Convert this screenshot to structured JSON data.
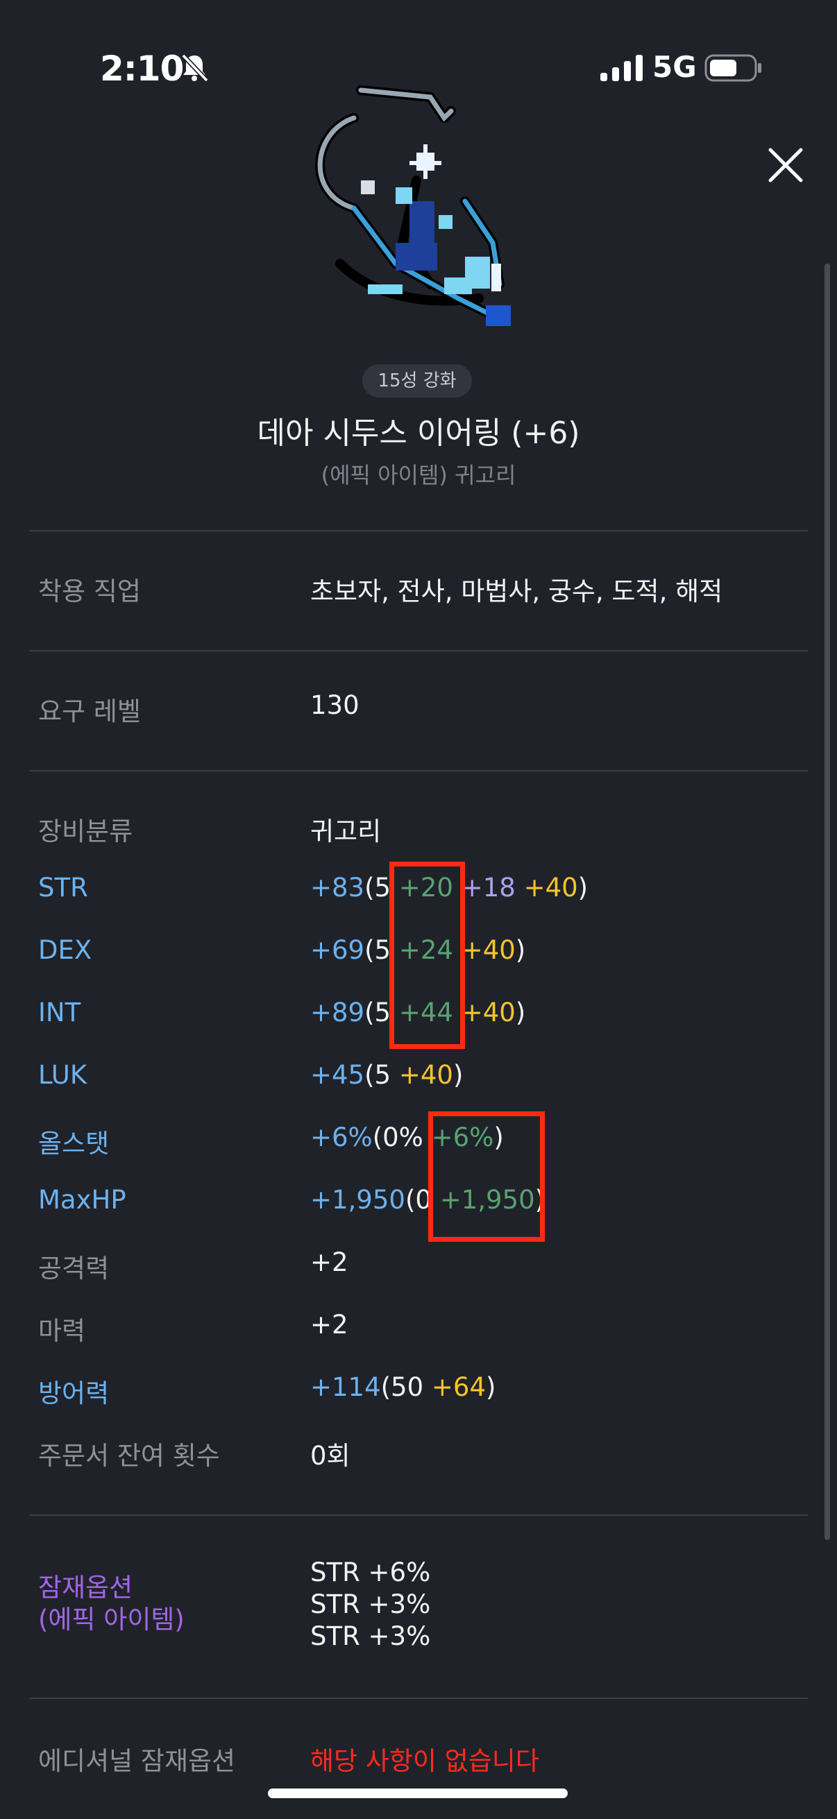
{
  "status_bar": {
    "time": "2:10",
    "network": "5G"
  },
  "item": {
    "badge": "15성 강화",
    "title": "데아 시두스 이어링 (+6)",
    "subtitle": "(에픽 아이템) 귀고리"
  },
  "rows": {
    "job": {
      "label": "착용 직업",
      "value": "초보자, 전사, 마법사, 궁수, 도적, 해적"
    },
    "level": {
      "label": "요구 레벨",
      "value": "130"
    },
    "category": {
      "label": "장비분류",
      "value": "귀고리"
    },
    "str": {
      "label": "STR",
      "total": "+83",
      "open": "(5 ",
      "bonus": "+20",
      "star": "+18",
      "enh": "+40",
      "close": ")"
    },
    "dex": {
      "label": "DEX",
      "total": "+69",
      "open": "(5 ",
      "bonus": "+24",
      "enh": "+40",
      "close": ")"
    },
    "int": {
      "label": "INT",
      "total": "+89",
      "open": "(5 ",
      "bonus": "+44",
      "enh": "+40",
      "close": ")"
    },
    "luk": {
      "label": "LUK",
      "total": "+45",
      "open": "(5 ",
      "enh": "+40",
      "close": ")"
    },
    "allstat": {
      "label": "올스탯",
      "total": "+6%",
      "open": "(0% ",
      "bonus": "+6%",
      "close": ")"
    },
    "maxhp": {
      "label": "MaxHP",
      "total": "+1,950",
      "open": "(0 ",
      "bonus": "+1,950",
      "close": ")"
    },
    "atk": {
      "label": "공격력",
      "value": "+2"
    },
    "magic": {
      "label": "마력",
      "value": "+2"
    },
    "def": {
      "label": "방어력",
      "total": "+114",
      "open": "(50 ",
      "enh": "+64",
      "close": ")"
    },
    "scroll": {
      "label": "주문서 잔여 횟수",
      "value": "0회"
    },
    "potential": {
      "label_line1": "잠재옵션",
      "label_line2": "(에픽 아이템)",
      "lines": [
        "STR +6%",
        "STR +3%",
        "STR +3%"
      ]
    },
    "additional": {
      "label": "에디셔널 잠재옵션",
      "value": "해당 사항이 없습니다"
    }
  },
  "colors": {
    "background": "#202229",
    "stat_blue": "#6cb2ee",
    "bonus_green": "#58a371",
    "star_lavender": "#a9a3f0",
    "enhance_gold": "#f4c52b",
    "potential_purple": "#a066e6",
    "none_red": "#ff2a1f",
    "highlight_red": "#ff2a12"
  }
}
